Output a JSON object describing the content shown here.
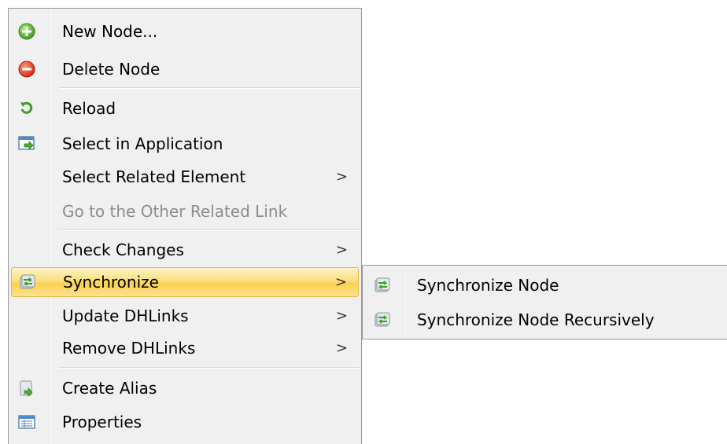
{
  "context_menu": {
    "items": [
      {
        "label": "New Node...",
        "icon": "add-circle-icon",
        "enabled": true,
        "submenu": false
      },
      {
        "label": "Delete Node",
        "icon": "delete-circle-icon",
        "enabled": true,
        "submenu": false
      },
      {
        "label": "Reload",
        "icon": "reload-icon",
        "enabled": true,
        "submenu": false
      },
      {
        "label": "Select in Application",
        "icon": "select-in-application-icon",
        "enabled": true,
        "submenu": false
      },
      {
        "label": "Select Related Element",
        "icon": "",
        "enabled": true,
        "submenu": true
      },
      {
        "label": "Go to the Other Related Link",
        "icon": "",
        "enabled": false,
        "submenu": false
      },
      {
        "label": "Check Changes",
        "icon": "",
        "enabled": true,
        "submenu": true
      },
      {
        "label": "Synchronize",
        "icon": "synchronize-icon",
        "enabled": true,
        "submenu": true,
        "highlighted": true
      },
      {
        "label": "Update DHLinks",
        "icon": "",
        "enabled": true,
        "submenu": true
      },
      {
        "label": "Remove DHLinks",
        "icon": "",
        "enabled": true,
        "submenu": true
      },
      {
        "label": "Create Alias",
        "icon": "create-alias-icon",
        "enabled": true,
        "submenu": false
      },
      {
        "label": "Properties",
        "icon": "properties-icon",
        "enabled": true,
        "submenu": false
      }
    ],
    "submenu_arrow": ">"
  },
  "synchronize_submenu": {
    "items": [
      {
        "label": "Synchronize Node",
        "icon": "synchronize-icon"
      },
      {
        "label": "Synchronize Node Recursively",
        "icon": "synchronize-icon"
      }
    ]
  },
  "colors": {
    "highlight_gradient_top": "#fdf3c6",
    "highlight_gradient_mid": "#f9d24f",
    "highlight_border": "#e5b84a",
    "menu_background": "#f0f0f0",
    "disabled_text": "#8d8d8d"
  }
}
